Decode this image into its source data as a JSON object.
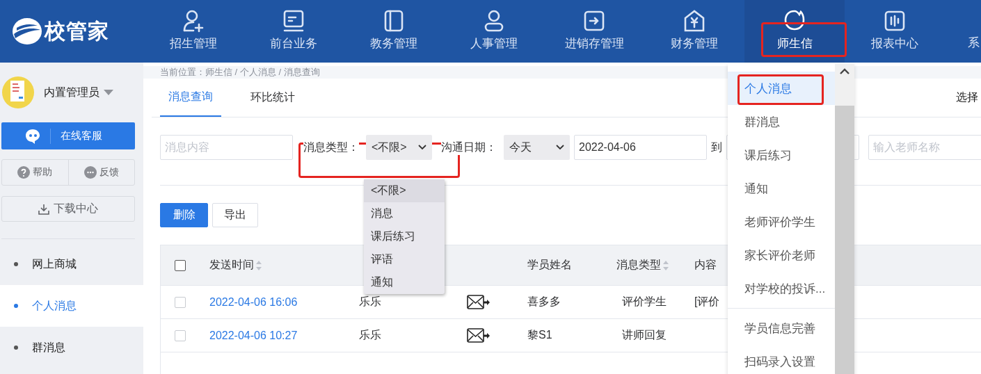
{
  "header": {
    "logo": "校管家",
    "nav": [
      {
        "label": "招生管理",
        "selected": false
      },
      {
        "label": "前台业务",
        "selected": false
      },
      {
        "label": "教务管理",
        "selected": false
      },
      {
        "label": "人事管理",
        "selected": false
      },
      {
        "label": "进销存管理",
        "selected": false
      },
      {
        "label": "财务管理",
        "selected": false
      },
      {
        "label": "师生信",
        "selected": true
      },
      {
        "label": "报表中心",
        "selected": false
      },
      {
        "label": "系",
        "selected": false
      }
    ]
  },
  "nav_menu": {
    "sections": [
      [
        {
          "label": "个人消息",
          "selected": true
        },
        {
          "label": "群消息",
          "selected": false
        },
        {
          "label": "课后练习",
          "selected": false
        },
        {
          "label": "通知",
          "selected": false
        },
        {
          "label": "老师评价学生",
          "selected": false
        },
        {
          "label": "家长评价老师",
          "selected": false
        },
        {
          "label": "对学校的投诉...",
          "selected": false
        }
      ],
      [
        {
          "label": "学员信息完善",
          "selected": false
        },
        {
          "label": "扫码录入设置",
          "selected": false
        }
      ]
    ]
  },
  "sidebar": {
    "user": "内置管理员",
    "service": "在线客服",
    "help": "帮助",
    "feedback": "反馈",
    "download": "下载中心",
    "items": [
      {
        "label": "网上商城",
        "selected": false
      },
      {
        "label": "个人消息",
        "selected": true
      },
      {
        "label": "群消息",
        "selected": false
      }
    ]
  },
  "breadcrumb": "当前位置：师生信 / 个人消息 / 消息查询",
  "tabs": [
    {
      "label": "消息查询",
      "selected": true
    },
    {
      "label": "环比统计",
      "selected": false
    }
  ],
  "tabs_right": "选择",
  "filters": {
    "content_placeholder": "消息内容",
    "type_label": "消息类型：",
    "type_value": "<不限>",
    "date_label": "沟通日期：",
    "date_range": "今天",
    "date_from": "2022-04-06",
    "to_label": "到",
    "teacher_placeholder": "输入老师名称",
    "type_options": [
      {
        "label": "<不限>",
        "selected": true
      },
      {
        "label": "消息",
        "selected": false
      },
      {
        "label": "课后练习",
        "selected": false
      },
      {
        "label": "评语",
        "selected": false
      },
      {
        "label": "通知",
        "selected": false
      }
    ]
  },
  "actions": [
    "删除",
    "导出"
  ],
  "table": {
    "all_checked": false,
    "columns": [
      {
        "label": "发送时间",
        "sortable": true
      },
      {
        "label": "学员姓名",
        "sortable": false
      },
      {
        "label": "消息类型",
        "sortable": true
      },
      {
        "label": "内容",
        "sortable": false
      }
    ],
    "rows": [
      {
        "time": "2022-04-06 16:06",
        "teacher": "乐乐",
        "student": "喜多多",
        "type": "评价学生",
        "content": "[评价",
        "checked": false
      },
      {
        "time": "2022-04-06 10:27",
        "teacher": "乐乐",
        "student": "黎S1",
        "type": "讲师回复",
        "content": "",
        "checked": false
      }
    ]
  }
}
